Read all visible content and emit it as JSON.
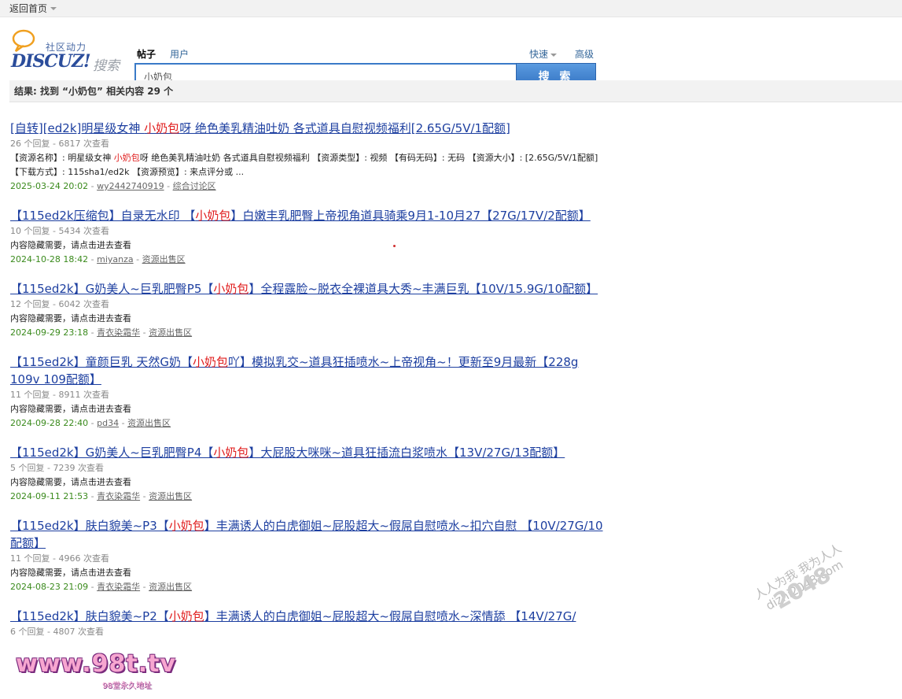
{
  "topbar": {
    "home_label": "返回首页"
  },
  "logo": {
    "tagline": "社区动力",
    "wordmark": "DISCUZ!",
    "search_word": "搜索"
  },
  "tabs": [
    {
      "label": "帖子",
      "active": true
    },
    {
      "label": "用户",
      "active": false
    }
  ],
  "search": {
    "value": "小奶包",
    "button_label": "搜 索",
    "quick_label": "快速",
    "advanced_label": "高级"
  },
  "result_summary": "结果: 找到 “小奶包” 相关内容 29 个",
  "results": [
    {
      "title_pre": "[自转][ed2k]明星级女神 ",
      "title_kw": "小奶包",
      "title_post": "呀 绝色美乳精油吐奶 各式道具自慰视频福利[2.65G/5V/1配额]",
      "meta": "26 个回复 - 6817 次查看",
      "desc_pre": "【资源名称】: 明星级女神 ",
      "desc_kw": "小奶包",
      "desc_post": "呀 绝色美乳精油吐奶 各式道具自慰视频福利 【资源类型】: 视频 【有码无码】: 无码 【资源大小】: [2.65G/5V/1配额] 【下载方式】: 115sha1/ed2k 【资源预览】: 来点评分或 ...",
      "date": "2025-03-24 20:02",
      "author": "wy2442740919",
      "forum": "综合讨论区"
    },
    {
      "title_pre": "【115ed2k压缩包】自录无水印 【",
      "title_kw": "小奶包",
      "title_post": "】白嫩丰乳肥臀上帝视角道具骑乘9月1-10月27【27G/17V/2配额】",
      "meta": "10 个回复 - 5434 次查看",
      "desc_pre": "内容隐藏需要，请点击进去查看",
      "desc_kw": "",
      "desc_post": "",
      "date": "2024-10-28 18:42",
      "author": "miyanza",
      "forum": "资源出售区"
    },
    {
      "title_pre": "【115ed2k】G奶美人~巨乳肥臀P5【",
      "title_kw": "小奶包",
      "title_post": "】全程露脸~脱衣全裸道具大秀~丰满巨乳【10V/15.9G/10配额】",
      "meta": "12 个回复 - 6042 次查看",
      "desc_pre": "内容隐藏需要，请点击进去查看",
      "desc_kw": "",
      "desc_post": "",
      "date": "2024-09-29 23:18",
      "author": "青衣染霜华",
      "forum": "资源出售区"
    },
    {
      "title_pre": "【115ed2k】童颜巨乳 天然G奶【",
      "title_kw": "小奶包",
      "title_post": "吖】模拟乳交~道具狂插喷水~上帝视角~！更新至9月最新【228g 109v 109配额】",
      "meta": "11 个回复 - 8911 次查看",
      "desc_pre": "内容隐藏需要，请点击进去查看",
      "desc_kw": "",
      "desc_post": "",
      "date": "2024-09-28 22:40",
      "author": "pd34",
      "forum": "资源出售区"
    },
    {
      "title_pre": "【115ed2k】G奶美人~巨乳肥臀P4【",
      "title_kw": "小奶包",
      "title_post": "】大屁股大咪咪~道具狂插流白浆喷水【13V/27G/13配额】",
      "meta": "5 个回复 - 7239 次查看",
      "desc_pre": "内容隐藏需要，请点击进去查看",
      "desc_kw": "",
      "desc_post": "",
      "date": "2024-09-11 21:53",
      "author": "青衣染霜华",
      "forum": "资源出售区"
    },
    {
      "title_pre": "【115ed2k】肤白貌美~P3【",
      "title_kw": "小奶包",
      "title_post": "】丰满诱人的白虎御姐~屁股超大~假屌自慰喷水~扣穴自慰 【10V/27G/10配额】",
      "meta": "11 个回复 - 4966 次查看",
      "desc_pre": "内容隐藏需要，请点击进去查看",
      "desc_kw": "",
      "desc_post": "",
      "date": "2024-08-23 21:09",
      "author": "青衣染霜华",
      "forum": "资源出售区"
    },
    {
      "title_pre": "【115ed2k】肤白貌美~P2【",
      "title_kw": "小奶包",
      "title_post": "】丰满诱人的白虎御姐~屁股超大~假屌自慰喷水~深情舔 【14V/27G/",
      "meta": "6 个回复 - 4807 次查看",
      "desc_pre": "",
      "desc_kw": "",
      "desc_post": "",
      "date": "",
      "author": "",
      "forum": ""
    }
  ],
  "watermarks": {
    "site98": "www.98t.tv",
    "site98_sub": "98堂永久地址",
    "site2048_big": "2048",
    "site2048_line1": "人人为我 我为人人",
    "site2048_line2": "dizhi2048.com"
  },
  "colors": {
    "link": "#1d3fa0",
    "keyword": "#e01c1c",
    "date": "#3a8a1c",
    "button": "#3a7ac8"
  }
}
